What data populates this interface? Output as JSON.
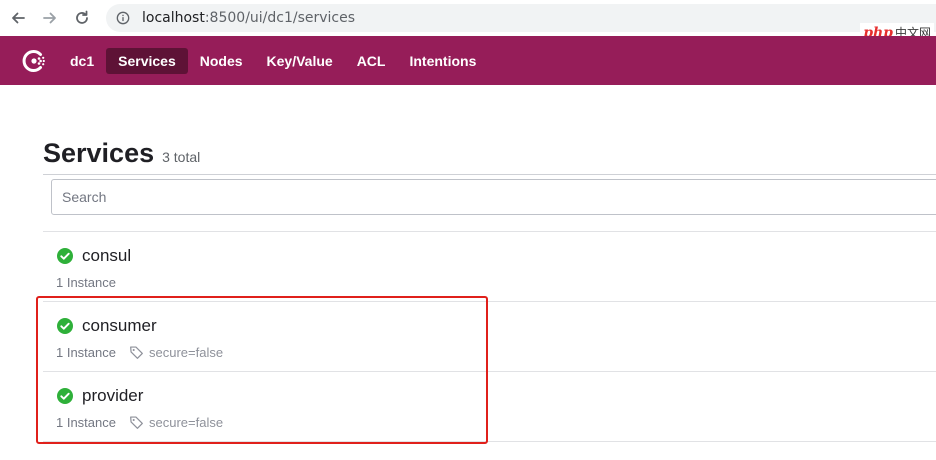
{
  "browser": {
    "url_host": "localhost",
    "url_rest": ":8500/ui/dc1/services"
  },
  "watermark": {
    "brand": "php",
    "suffix": "中文网"
  },
  "nav": {
    "datacenter": "dc1",
    "items": [
      {
        "label": "Services",
        "active": true
      },
      {
        "label": "Nodes",
        "active": false
      },
      {
        "label": "Key/Value",
        "active": false
      },
      {
        "label": "ACL",
        "active": false
      },
      {
        "label": "Intentions",
        "active": false
      }
    ]
  },
  "page": {
    "title": "Services",
    "count": "3 total",
    "search_placeholder": "Search"
  },
  "services": [
    {
      "name": "consul",
      "instances": "1 Instance",
      "tag": ""
    },
    {
      "name": "consumer",
      "instances": "1 Instance",
      "tag": "secure=false"
    },
    {
      "name": "provider",
      "instances": "1 Instance",
      "tag": "secure=false"
    }
  ],
  "colors": {
    "brand": "#961d59",
    "nav_active": "#5e1236",
    "passing": "#2eb039",
    "highlight": "#e0201b"
  }
}
